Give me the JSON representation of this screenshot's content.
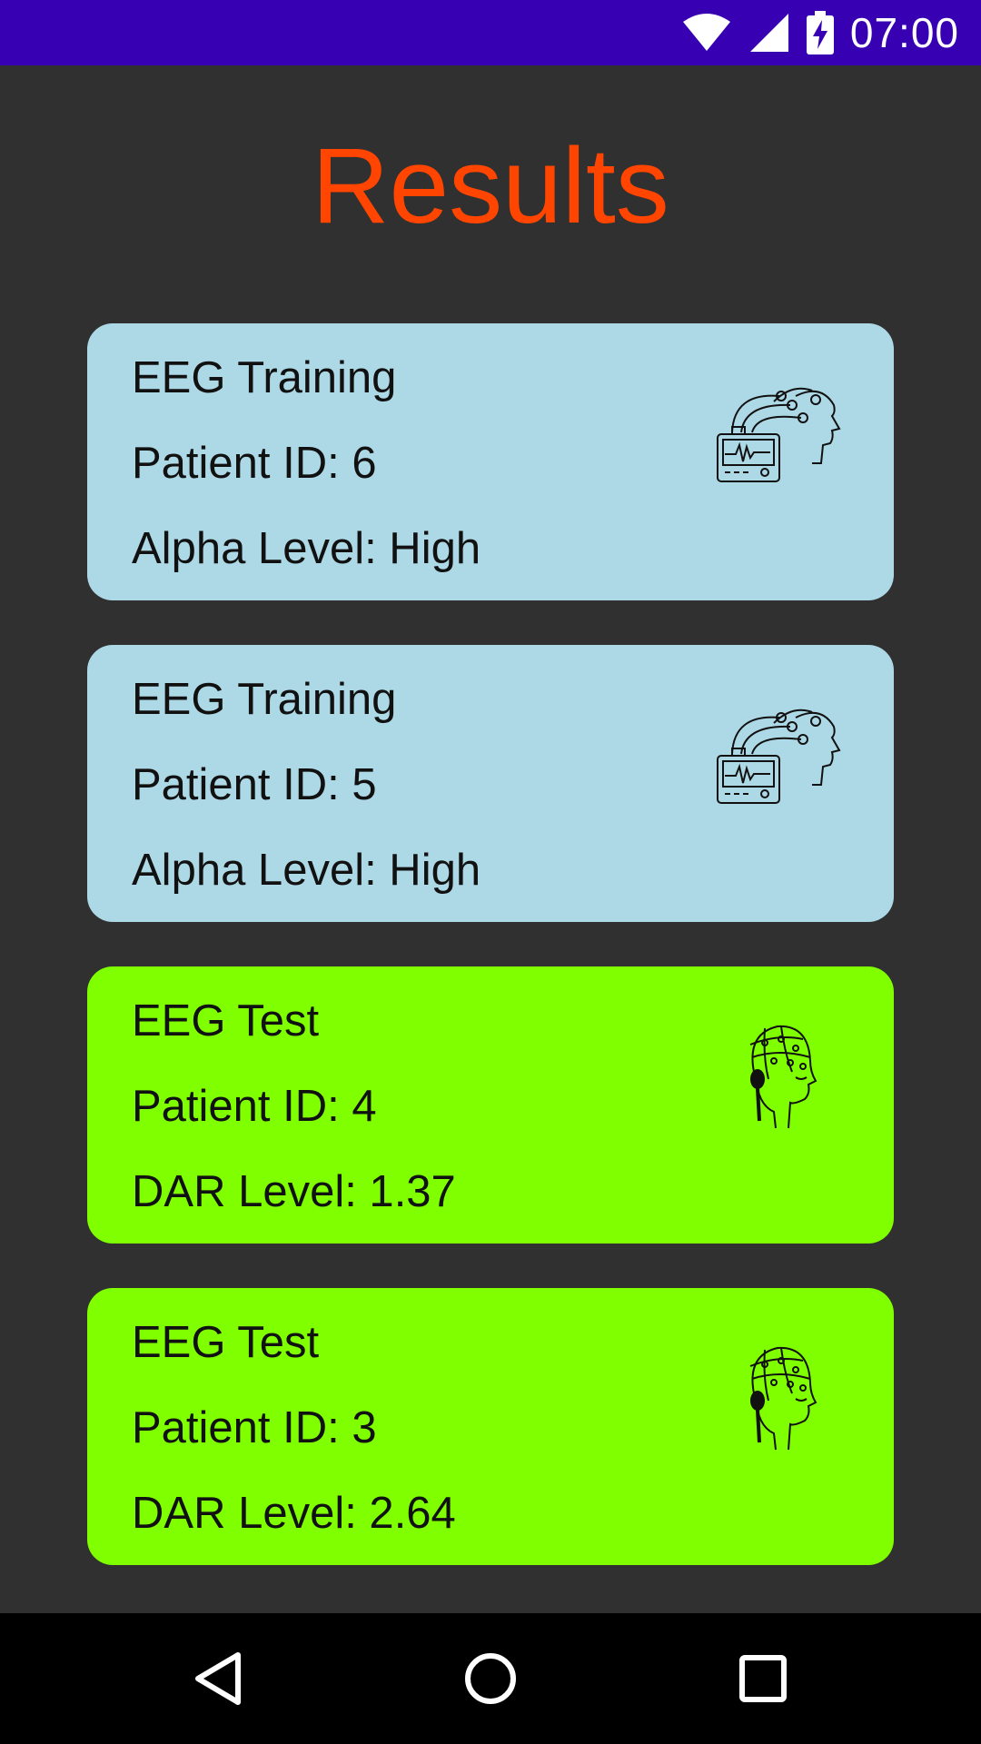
{
  "status_bar": {
    "time": "07:00",
    "icons": [
      "wifi-icon",
      "signal-icon",
      "battery-charging-icon"
    ],
    "background": "#3700b3"
  },
  "page": {
    "title": "Results",
    "title_color": "#ff4500",
    "background": "#303030"
  },
  "results": [
    {
      "type": "EEG Training",
      "patient": "Patient ID: 6",
      "metric": "Alpha Level: High",
      "color": "#add8e6",
      "icon": "eeg-monitor-head-icon"
    },
    {
      "type": "EEG Training",
      "patient": "Patient ID: 5",
      "metric": "Alpha Level: High",
      "color": "#add8e6",
      "icon": "eeg-monitor-head-icon"
    },
    {
      "type": "EEG Test",
      "patient": "Patient ID: 4",
      "metric": "DAR Level: 1.37",
      "color": "#7fff00",
      "icon": "eeg-cap-head-icon"
    },
    {
      "type": "EEG Test",
      "patient": "Patient ID: 3",
      "metric": "DAR Level: 2.64",
      "color": "#7fff00",
      "icon": "eeg-cap-head-icon"
    }
  ],
  "nav_bar": {
    "buttons": [
      "back-icon",
      "home-icon",
      "recents-icon"
    ]
  }
}
